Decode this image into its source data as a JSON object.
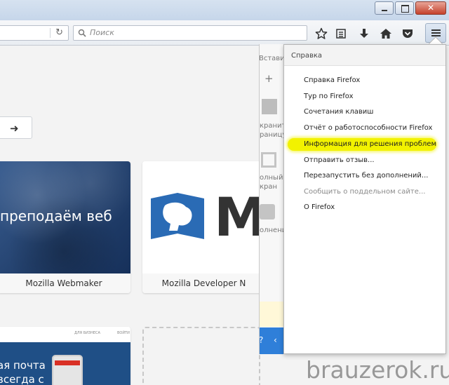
{
  "toolbar": {
    "search_placeholder": "Поиск"
  },
  "tiles": [
    {
      "label": "Mozilla Webmaker",
      "thumb_text": "преподаём веб"
    },
    {
      "label": "Mozilla Developer N",
      "logo_text": "M"
    },
    {
      "thumb_line1": "ая почта",
      "thumb_line2": "всегда с",
      "nav1": "ДЛЯ БИЗНЕСА",
      "nav2": "ВОЙТИ"
    }
  ],
  "customize_panel": {
    "texts": [
      "Вставит",
      "+",
      "кранит",
      "раницу",
      "олный",
      "кран",
      "олнени"
    ]
  },
  "help_menu": {
    "header": "Справка",
    "items": [
      {
        "label": "Справка Firefox",
        "disabled": false
      },
      {
        "label": "Тур по Firefox",
        "disabled": false
      },
      {
        "label": "Сочетания клавиш",
        "disabled": false
      },
      {
        "label": "Отчёт о работоспособности Firefox",
        "disabled": false
      },
      {
        "label": "Информация для решения проблем",
        "disabled": false,
        "highlighted": true
      },
      {
        "label": "Отправить отзыв...",
        "disabled": false
      },
      {
        "label": "Перезапустить без дополнений...",
        "disabled": false
      },
      {
        "label": "Сообщить о поддельном сайте...",
        "disabled": true
      },
      {
        "label": "О Firefox",
        "disabled": false
      }
    ]
  },
  "watermark": "brauzerok.ru",
  "colors": {
    "highlight": "#f2f200",
    "panel_blue": "#2f7fd9",
    "webmaker_bg": "#23416e",
    "mdn_blue": "#2a6bb5"
  }
}
